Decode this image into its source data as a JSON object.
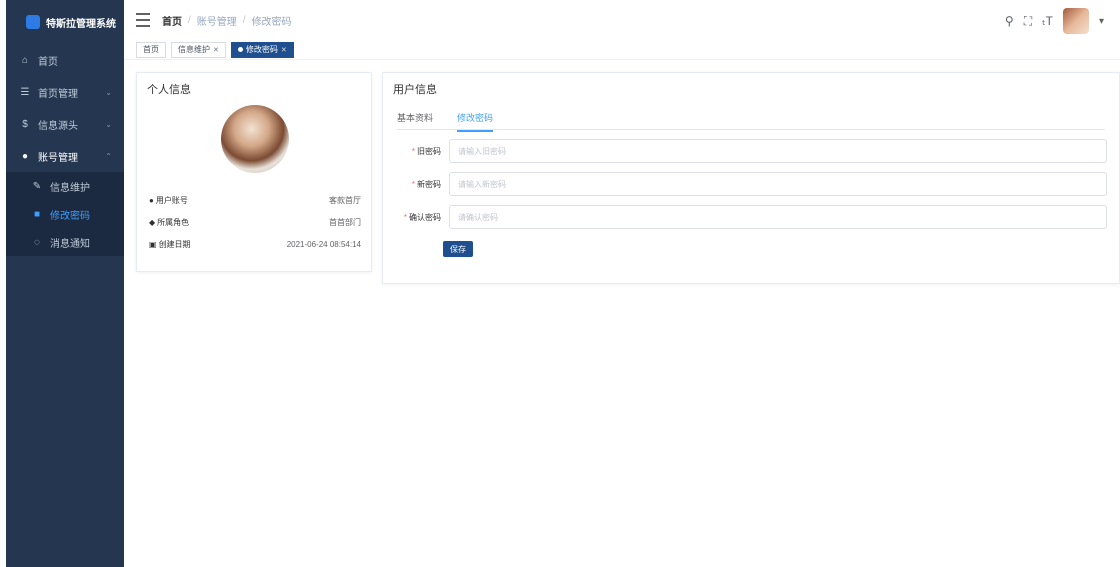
{
  "app": {
    "title": "特斯拉管理系统"
  },
  "sidebar": {
    "items": [
      {
        "icon": "home-icon",
        "label": "首页"
      },
      {
        "icon": "list-icon",
        "label": "首页管理",
        "arrow": "⌄"
      },
      {
        "icon": "dollar-icon",
        "label": "信息源头",
        "arrow": "⌄"
      },
      {
        "icon": "user-icon",
        "label": "账号管理",
        "arrow": "⌃"
      }
    ],
    "submenu": [
      {
        "icon": "edit-icon",
        "label": "信息维护"
      },
      {
        "icon": "lock-icon",
        "label": "修改密码"
      },
      {
        "icon": "bell-icon",
        "label": "消息通知"
      }
    ]
  },
  "navbar": {
    "breadcrumb": [
      "首页",
      "账号管理",
      "修改密码"
    ],
    "breadcrumb_sep": "/"
  },
  "tags": [
    {
      "label": "首页",
      "active": false,
      "closable": false
    },
    {
      "label": "信息维护",
      "active": false,
      "closable": true
    },
    {
      "label": "修改密码",
      "active": true,
      "closable": true
    }
  ],
  "profile": {
    "title": "个人信息",
    "rows": [
      {
        "label": "用户账号",
        "value": "客款首厅"
      },
      {
        "label": "所属角色",
        "value": "首首部门"
      },
      {
        "label": "创建日期",
        "value": "2021-06-24 08:54:14"
      }
    ]
  },
  "user_info": {
    "title": "用户信息",
    "tabs": [
      {
        "label": "基本资料",
        "active": false
      },
      {
        "label": "修改密码",
        "active": true
      }
    ],
    "fields": [
      {
        "label": "旧密码",
        "placeholder": "请输入旧密码",
        "required": true
      },
      {
        "label": "新密码",
        "placeholder": "请输入新密码",
        "required": true
      },
      {
        "label": "确认密码",
        "placeholder": "请确认密码",
        "required": true
      }
    ],
    "save_label": "保存"
  },
  "colors": {
    "sidebar_bg": "#243650",
    "accent": "#409eff",
    "primary_button": "#1f4f8f",
    "required": "#f56c6c"
  }
}
